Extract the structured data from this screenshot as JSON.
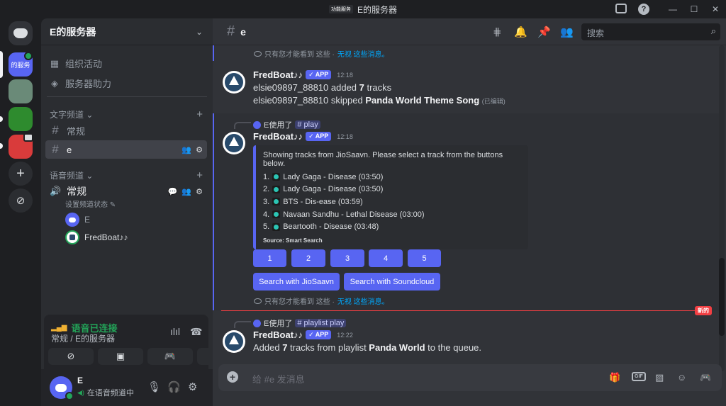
{
  "window": {
    "title": "E的服务器",
    "app_badge": "功能服务"
  },
  "guilds": {
    "active_label": "的服务"
  },
  "sidebar": {
    "server_name": "E的服务器",
    "links": [
      {
        "label": "组织活动"
      },
      {
        "label": "服务器助力"
      }
    ],
    "text_category": "文字频道",
    "text_channels": [
      {
        "name": "常规"
      },
      {
        "name": "e"
      }
    ],
    "voice_category": "语音频道",
    "voice_channel": {
      "name": "常规",
      "status_hint": "设置频道状态"
    },
    "voice_members": [
      {
        "name": "E"
      },
      {
        "name": "FredBoat♪♪"
      }
    ]
  },
  "voice_panel": {
    "connected": "语音已连接",
    "location": "常规 / E的服务器"
  },
  "user": {
    "name": "E",
    "status": "在语音频道中"
  },
  "channel": {
    "name": "e",
    "search_placeholder": "搜索"
  },
  "messages": {
    "ephemeral_text": "只有您才能看到 这些 ·",
    "ephemeral_dismiss": "无视 这些消息。",
    "msg1": {
      "author": "FredBoat♪♪",
      "app_tag": "APP",
      "time": "12:18",
      "line1_prefix": "elsie09897_88810 added ",
      "line1_count": "7",
      "line1_suffix": " tracks",
      "line2_prefix": "elsie09897_88810 skipped ",
      "line2_track": "Panda World Theme Song",
      "line2_edited": "(已编辑)"
    },
    "msg2": {
      "reply_user": "E使用了",
      "reply_cmd": "play",
      "author": "FredBoat♪♪",
      "app_tag": "APP",
      "time": "12:18",
      "embed_desc": "Showing tracks from JioSaavn. Please select a track from the buttons below.",
      "tracks": [
        {
          "num": "1.",
          "title": "Lady Gaga - Disease (03:50)"
        },
        {
          "num": "2.",
          "title": "Lady Gaga - Disease (03:50)"
        },
        {
          "num": "3.",
          "title": "BTS - Dis-ease (03:59)"
        },
        {
          "num": "4.",
          "title": "Navaan Sandhu - Lethal Disease (03:00)"
        },
        {
          "num": "5.",
          "title": "Beartooth - Disease (03:48)"
        }
      ],
      "source": "Source: Smart Search",
      "buttons": [
        "1",
        "2",
        "3",
        "4",
        "5"
      ],
      "search_jiosaavn": "Search with JioSaavn",
      "search_soundcloud": "Search with Soundcloud"
    },
    "new_label": "新的",
    "msg3": {
      "reply_user": "E使用了",
      "reply_cmd": "playlist play",
      "author": "FredBoat♪♪",
      "app_tag": "APP",
      "time": "12:22",
      "text_prefix": "Added ",
      "text_count": "7",
      "text_mid": " tracks from playlist ",
      "text_playlist": "Panda World",
      "text_suffix": " to the queue."
    }
  },
  "composer": {
    "placeholder": "给 #e 发消息",
    "gif": "GIF"
  },
  "colors": {
    "accent": "#5865f2",
    "online": "#23a559",
    "new": "#f23f43"
  }
}
